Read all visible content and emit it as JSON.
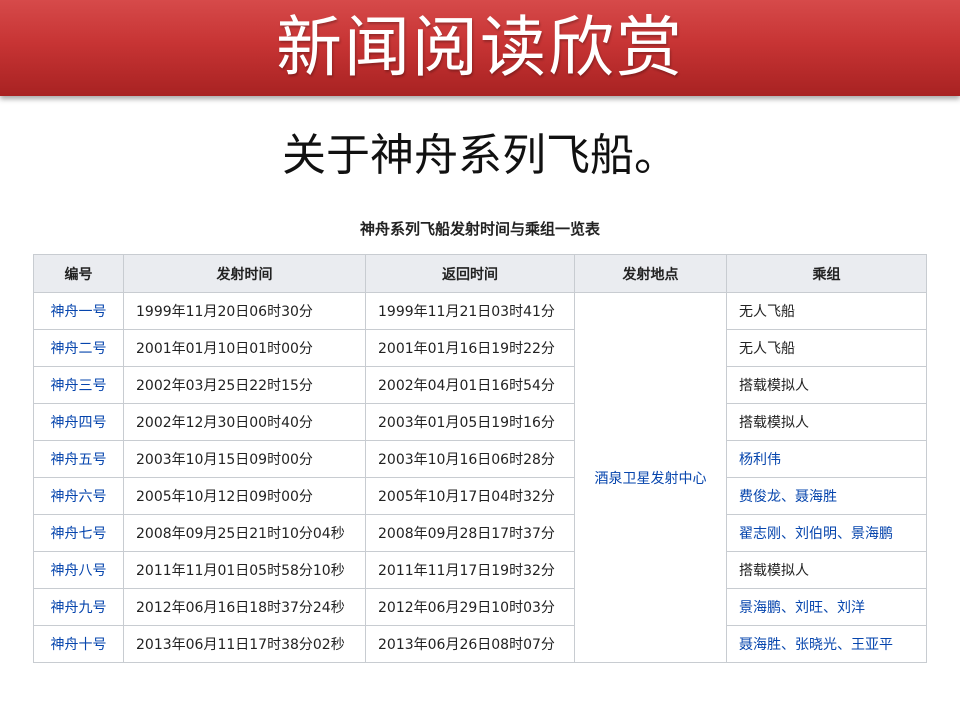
{
  "banner": {
    "title": "新闻阅读欣赏"
  },
  "subtitle": "关于神舟系列飞船。",
  "table": {
    "caption": "神舟系列飞船发射时间与乘组一览表",
    "headers": [
      "编号",
      "发射时间",
      "返回时间",
      "发射地点",
      "乘组"
    ],
    "launch_site": "酒泉卫星发射中心",
    "rows": [
      {
        "id": "神舟一号",
        "launch": "1999年11月20日06时30分",
        "return": "1999年11月21日03时41分",
        "crew": "无人飞船",
        "crew_link": false
      },
      {
        "id": "神舟二号",
        "launch": "2001年01月10日01时00分",
        "return": "2001年01月16日19时22分",
        "crew": "无人飞船",
        "crew_link": false
      },
      {
        "id": "神舟三号",
        "launch": "2002年03月25日22时15分",
        "return": "2002年04月01日16时54分",
        "crew": "搭载模拟人",
        "crew_link": false
      },
      {
        "id": "神舟四号",
        "launch": "2002年12月30日00时40分",
        "return": "2003年01月05日19时16分",
        "crew": "搭载模拟人",
        "crew_link": false
      },
      {
        "id": "神舟五号",
        "launch": "2003年10月15日09时00分",
        "return": "2003年10月16日06时28分",
        "crew": "杨利伟",
        "crew_link": true
      },
      {
        "id": "神舟六号",
        "launch": "2005年10月12日09时00分",
        "return": "2005年10月17日04时32分",
        "crew": "费俊龙、聂海胜",
        "crew_link": true
      },
      {
        "id": "神舟七号",
        "launch": "2008年09月25日21时10分04秒",
        "return": "2008年09月28日17时37分",
        "crew": "翟志刚、刘伯明、景海鹏",
        "crew_link": true
      },
      {
        "id": "神舟八号",
        "launch": "2011年11月01日05时58分10秒",
        "return": "2011年11月17日19时32分",
        "crew": "搭载模拟人",
        "crew_link": false
      },
      {
        "id": "神舟九号",
        "launch": "2012年06月16日18时37分24秒",
        "return": "2012年06月29日10时03分",
        "crew": "景海鹏、刘旺、刘洋",
        "crew_link": true
      },
      {
        "id": "神舟十号",
        "launch": "2013年06月11日17时38分02秒",
        "return": "2013年06月26日08时07分",
        "crew": "聂海胜、张晓光、王亚平",
        "crew_link": true
      }
    ]
  },
  "colors": {
    "banner": "#c73434",
    "link": "#0645ad",
    "header_bg": "#eaecf0",
    "border": "#c8ccd1"
  }
}
